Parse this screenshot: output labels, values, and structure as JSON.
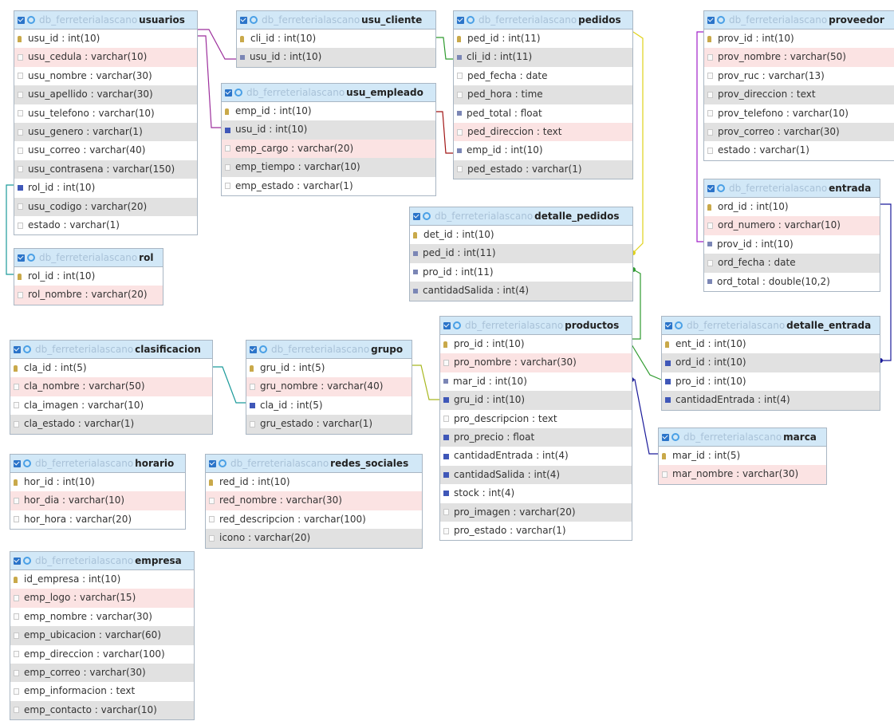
{
  "db_name": "db_ferreterialascano",
  "tables": [
    {
      "id": "usuarios",
      "name": "usuarios",
      "fields": [
        {
          "t": "usu_id : int(10)",
          "i": "key",
          "bg": ""
        },
        {
          "t": "usu_cedula : varchar(10)",
          "i": "plain",
          "bg": "pink"
        },
        {
          "t": "usu_nombre : varchar(30)",
          "i": "plain",
          "bg": ""
        },
        {
          "t": "usu_apellido : varchar(30)",
          "i": "plain",
          "bg": "alt"
        },
        {
          "t": "usu_telefono : varchar(10)",
          "i": "plain",
          "bg": ""
        },
        {
          "t": "usu_genero : varchar(1)",
          "i": "plain",
          "bg": "alt"
        },
        {
          "t": "usu_correo : varchar(40)",
          "i": "plain",
          "bg": ""
        },
        {
          "t": "usu_contrasena : varchar(150)",
          "i": "plain",
          "bg": "alt"
        },
        {
          "t": "rol_id : int(10)",
          "i": "fk",
          "bg": ""
        },
        {
          "t": "usu_codigo : varchar(20)",
          "i": "plain",
          "bg": "alt"
        },
        {
          "t": "estado : varchar(1)",
          "i": "plain",
          "bg": ""
        }
      ]
    },
    {
      "id": "rol",
      "name": "rol",
      "fields": [
        {
          "t": "rol_id : int(10)",
          "i": "key",
          "bg": ""
        },
        {
          "t": "rol_nombre : varchar(20)",
          "i": "plain",
          "bg": "pink"
        }
      ]
    },
    {
      "id": "usu_cliente",
      "name": "usu_cliente",
      "fields": [
        {
          "t": "cli_id : int(10)",
          "i": "key",
          "bg": ""
        },
        {
          "t": "usu_id : int(10)",
          "i": "num",
          "bg": "alt"
        }
      ]
    },
    {
      "id": "usu_empleado",
      "name": "usu_empleado",
      "fields": [
        {
          "t": "emp_id : int(10)",
          "i": "key",
          "bg": ""
        },
        {
          "t": "usu_id : int(10)",
          "i": "fk",
          "bg": "alt"
        },
        {
          "t": "emp_cargo : varchar(20)",
          "i": "plain",
          "bg": "pink"
        },
        {
          "t": "emp_tiempo : varchar(10)",
          "i": "plain",
          "bg": "alt"
        },
        {
          "t": "emp_estado : varchar(1)",
          "i": "plain",
          "bg": ""
        }
      ]
    },
    {
      "id": "pedidos",
      "name": "pedidos",
      "fields": [
        {
          "t": "ped_id : int(11)",
          "i": "key",
          "bg": ""
        },
        {
          "t": "cli_id : int(11)",
          "i": "num",
          "bg": "alt"
        },
        {
          "t": "ped_fecha : date",
          "i": "plain",
          "bg": ""
        },
        {
          "t": "ped_hora : time",
          "i": "plain",
          "bg": "alt"
        },
        {
          "t": "ped_total : float",
          "i": "num",
          "bg": ""
        },
        {
          "t": "ped_direccion : text",
          "i": "plain",
          "bg": "pink"
        },
        {
          "t": "emp_id : int(10)",
          "i": "num",
          "bg": ""
        },
        {
          "t": "ped_estado : varchar(1)",
          "i": "plain",
          "bg": "alt"
        }
      ]
    },
    {
      "id": "proveedor",
      "name": "proveedor",
      "fields": [
        {
          "t": "prov_id : int(10)",
          "i": "key",
          "bg": ""
        },
        {
          "t": "prov_nombre : varchar(50)",
          "i": "plain",
          "bg": "pink"
        },
        {
          "t": "prov_ruc : varchar(13)",
          "i": "plain",
          "bg": ""
        },
        {
          "t": "prov_direccion : text",
          "i": "plain",
          "bg": "alt"
        },
        {
          "t": "prov_telefono : varchar(10)",
          "i": "plain",
          "bg": ""
        },
        {
          "t": "prov_correo : varchar(30)",
          "i": "plain",
          "bg": "alt"
        },
        {
          "t": "estado : varchar(1)",
          "i": "plain",
          "bg": ""
        }
      ]
    },
    {
      "id": "entrada",
      "name": "entrada",
      "fields": [
        {
          "t": "ord_id : int(10)",
          "i": "key",
          "bg": ""
        },
        {
          "t": "ord_numero : varchar(10)",
          "i": "plain",
          "bg": "pink"
        },
        {
          "t": "prov_id : int(10)",
          "i": "num",
          "bg": ""
        },
        {
          "t": "ord_fecha : date",
          "i": "plain",
          "bg": "alt"
        },
        {
          "t": "ord_total : double(10,2)",
          "i": "num",
          "bg": ""
        }
      ]
    },
    {
      "id": "detalle_pedidos",
      "name": "detalle_pedidos",
      "fields": [
        {
          "t": "det_id : int(10)",
          "i": "key",
          "bg": ""
        },
        {
          "t": "ped_id : int(11)",
          "i": "num",
          "bg": "alt"
        },
        {
          "t": "pro_id : int(11)",
          "i": "num",
          "bg": ""
        },
        {
          "t": "cantidadSalida : int(4)",
          "i": "num",
          "bg": "alt"
        }
      ]
    },
    {
      "id": "productos",
      "name": "productos",
      "fields": [
        {
          "t": "pro_id : int(10)",
          "i": "key",
          "bg": ""
        },
        {
          "t": "pro_nombre : varchar(30)",
          "i": "plain",
          "bg": "pink"
        },
        {
          "t": "mar_id : int(10)",
          "i": "num",
          "bg": ""
        },
        {
          "t": "gru_id : int(10)",
          "i": "fk",
          "bg": "alt"
        },
        {
          "t": "pro_descripcion : text",
          "i": "plain",
          "bg": ""
        },
        {
          "t": "pro_precio : float",
          "i": "fk",
          "bg": "alt"
        },
        {
          "t": "cantidadEntrada : int(4)",
          "i": "fk",
          "bg": ""
        },
        {
          "t": "cantidadSalida : int(4)",
          "i": "fk",
          "bg": "alt"
        },
        {
          "t": "stock : int(4)",
          "i": "fk",
          "bg": ""
        },
        {
          "t": "pro_imagen : varchar(20)",
          "i": "plain",
          "bg": "alt"
        },
        {
          "t": "pro_estado : varchar(1)",
          "i": "plain",
          "bg": ""
        }
      ]
    },
    {
      "id": "detalle_entrada",
      "name": "detalle_entrada",
      "fields": [
        {
          "t": "ent_id : int(10)",
          "i": "key",
          "bg": ""
        },
        {
          "t": "ord_id : int(10)",
          "i": "fk",
          "bg": "alt"
        },
        {
          "t": "pro_id : int(10)",
          "i": "fk",
          "bg": ""
        },
        {
          "t": "cantidadEntrada : int(4)",
          "i": "fk",
          "bg": "alt"
        }
      ]
    },
    {
      "id": "marca",
      "name": "marca",
      "fields": [
        {
          "t": "mar_id : int(5)",
          "i": "key",
          "bg": ""
        },
        {
          "t": "mar_nombre : varchar(30)",
          "i": "plain",
          "bg": "pink"
        }
      ]
    },
    {
      "id": "clasificacion",
      "name": "clasificacion",
      "fields": [
        {
          "t": "cla_id : int(5)",
          "i": "key",
          "bg": ""
        },
        {
          "t": "cla_nombre : varchar(50)",
          "i": "plain",
          "bg": "pink"
        },
        {
          "t": "cla_imagen : varchar(10)",
          "i": "plain",
          "bg": ""
        },
        {
          "t": "cla_estado : varchar(1)",
          "i": "plain",
          "bg": "alt"
        }
      ]
    },
    {
      "id": "grupo",
      "name": "grupo",
      "fields": [
        {
          "t": "gru_id : int(5)",
          "i": "key",
          "bg": ""
        },
        {
          "t": "gru_nombre : varchar(40)",
          "i": "plain",
          "bg": "pink"
        },
        {
          "t": "cla_id : int(5)",
          "i": "fk",
          "bg": ""
        },
        {
          "t": "gru_estado : varchar(1)",
          "i": "plain",
          "bg": "alt"
        }
      ]
    },
    {
      "id": "horario",
      "name": "horario",
      "fields": [
        {
          "t": "hor_id : int(10)",
          "i": "key",
          "bg": ""
        },
        {
          "t": "hor_dia : varchar(10)",
          "i": "plain",
          "bg": "pink"
        },
        {
          "t": "hor_hora : varchar(20)",
          "i": "plain",
          "bg": ""
        }
      ]
    },
    {
      "id": "redes_sociales",
      "name": "redes_sociales",
      "fields": [
        {
          "t": "red_id : int(10)",
          "i": "key",
          "bg": ""
        },
        {
          "t": "red_nombre : varchar(30)",
          "i": "plain",
          "bg": "pink"
        },
        {
          "t": "red_descripcion : varchar(100)",
          "i": "plain",
          "bg": ""
        },
        {
          "t": "icono : varchar(20)",
          "i": "plain",
          "bg": "alt"
        }
      ]
    },
    {
      "id": "empresa",
      "name": "empresa",
      "fields": [
        {
          "t": "id_empresa : int(10)",
          "i": "key",
          "bg": ""
        },
        {
          "t": "emp_logo : varchar(15)",
          "i": "plain",
          "bg": "pink"
        },
        {
          "t": "emp_nombre : varchar(30)",
          "i": "plain",
          "bg": ""
        },
        {
          "t": "emp_ubicacion : varchar(60)",
          "i": "plain",
          "bg": "alt"
        },
        {
          "t": "emp_direccion : varchar(100)",
          "i": "plain",
          "bg": ""
        },
        {
          "t": "emp_correo : varchar(30)",
          "i": "plain",
          "bg": "alt"
        },
        {
          "t": "emp_informacion : text",
          "i": "plain",
          "bg": ""
        },
        {
          "t": "emp_contacto : varchar(10)",
          "i": "plain",
          "bg": "alt"
        }
      ]
    }
  ],
  "relations": [
    {
      "from": "usuarios",
      "to": "usu_cliente",
      "color": "#9c2f9c"
    },
    {
      "from": "usuarios",
      "to": "usu_empleado",
      "color": "#9c2f9c"
    },
    {
      "from": "usu_cliente",
      "to": "pedidos",
      "color": "#2e9b2e"
    },
    {
      "from": "usu_empleado",
      "to": "pedidos",
      "color": "#a11515"
    },
    {
      "from": "rol",
      "to": "usuarios",
      "color": "#1b9a9a"
    },
    {
      "from": "pedidos",
      "to": "detalle_pedidos",
      "color": "#e0d21a"
    },
    {
      "from": "productos",
      "to": "detalle_pedidos",
      "color": "#2e9b2e"
    },
    {
      "from": "productos",
      "to": "detalle_entrada",
      "color": "#2e9b2e"
    },
    {
      "from": "entrada",
      "to": "detalle_entrada",
      "color": "#1a1a9a"
    },
    {
      "from": "proveedor",
      "to": "entrada",
      "color": "#a020c8"
    },
    {
      "from": "marca",
      "to": "productos",
      "color": "#1a1a9a"
    },
    {
      "from": "grupo",
      "to": "productos",
      "color": "#a8b820"
    },
    {
      "from": "clasificacion",
      "to": "grupo",
      "color": "#1b9a9a"
    }
  ]
}
